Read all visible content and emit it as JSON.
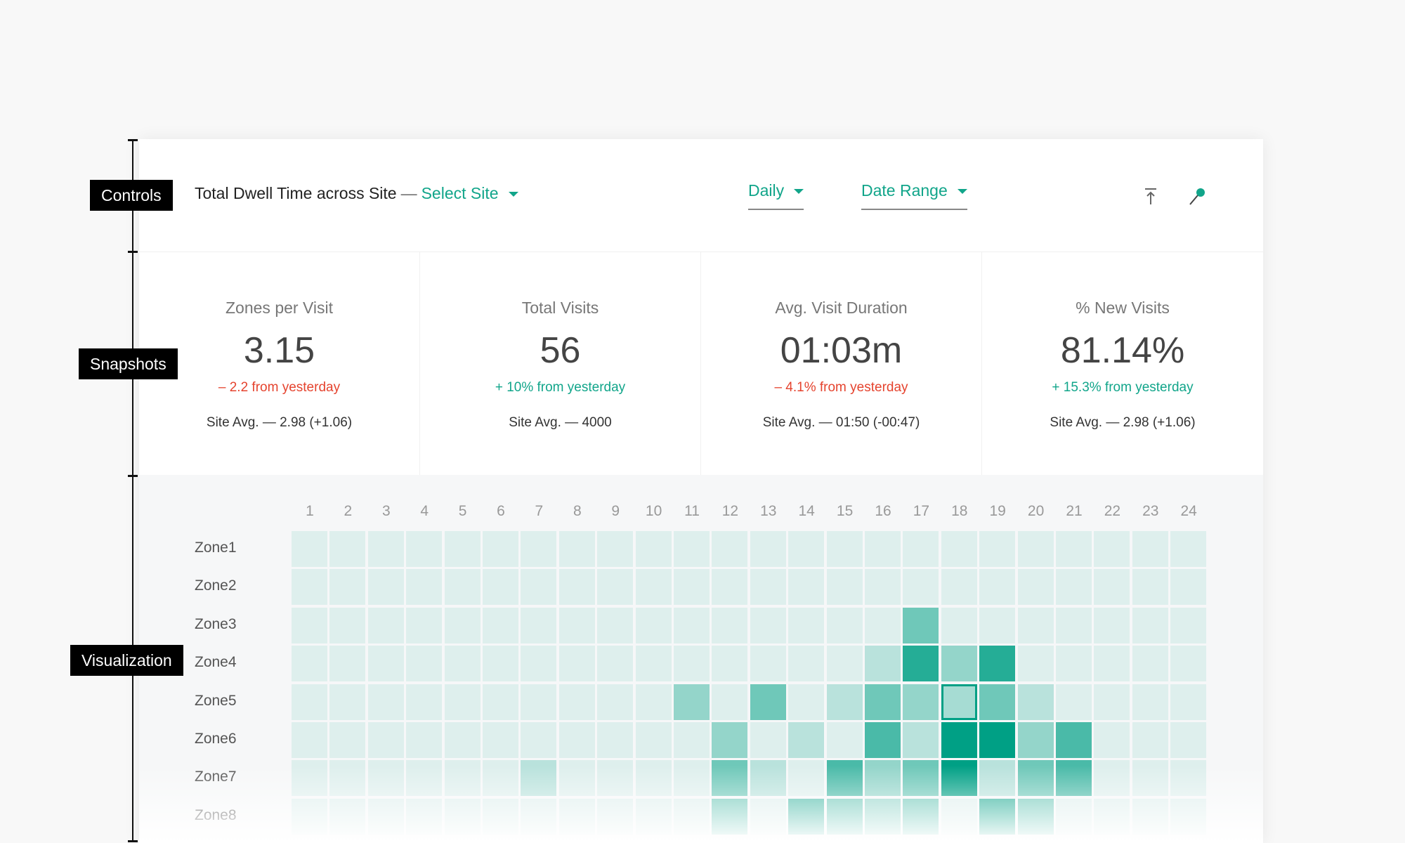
{
  "annotations": [
    "Controls",
    "Snapshots",
    "Visualization"
  ],
  "controls": {
    "title": "Total Dwell Time across Site",
    "separator": "—",
    "site_select": "Select Site",
    "interval": "Daily",
    "date_range": "Date Range"
  },
  "snapshots": [
    {
      "label": "Zones per Visit",
      "value": "3.15",
      "change": "– 2.2 from yesterday",
      "trend": "negative",
      "site_avg": "Site Avg. — 2.98 (+1.06)"
    },
    {
      "label": "Total Visits",
      "value": "56",
      "change": "+ 10% from yesterday",
      "trend": "positive",
      "site_avg": "Site Avg. — 4000"
    },
    {
      "label": "Avg. Visit Duration",
      "value": "01:03m",
      "change": "– 4.1% from yesterday",
      "trend": "negative",
      "site_avg": "Site Avg. — 01:50 (-00:47)"
    },
    {
      "label": "% New Visits",
      "value": "81.14%",
      "change": "+ 15.3% from yesterday",
      "trend": "positive",
      "site_avg": "Site Avg. — 2.98 (+1.06)"
    }
  ],
  "colors": {
    "accent": "#11a58a",
    "negative": "#e5432e",
    "cell_low": "#deefed",
    "cell_high": "#00a085"
  },
  "chart_data": {
    "type": "heatmap",
    "x": [
      "1",
      "2",
      "3",
      "4",
      "5",
      "6",
      "7",
      "8",
      "9",
      "10",
      "11",
      "12",
      "13",
      "14",
      "15",
      "16",
      "17",
      "18",
      "19",
      "20",
      "21",
      "22",
      "23",
      "24"
    ],
    "y": [
      "Zone1",
      "Zone2",
      "Zone3",
      "Zone4",
      "Zone5",
      "Zone6",
      "Zone7",
      "Zone8"
    ],
    "values": [
      [
        0,
        0,
        0,
        0,
        0,
        0,
        0,
        0,
        0,
        0,
        0,
        0,
        0,
        0,
        0,
        0,
        0,
        0,
        0,
        0,
        0,
        0,
        0,
        0
      ],
      [
        0,
        0,
        0,
        0,
        0,
        0,
        0,
        0,
        0,
        0,
        0,
        0,
        0,
        0,
        0,
        0,
        0,
        0,
        0,
        0,
        0,
        0,
        0,
        0
      ],
      [
        0,
        0,
        0,
        0,
        0,
        0,
        0,
        0,
        0,
        0,
        0,
        0,
        0,
        0,
        0,
        0,
        3,
        0,
        0,
        0,
        0,
        0,
        0,
        0
      ],
      [
        0,
        0,
        0,
        0,
        0,
        0,
        0,
        0,
        0,
        0,
        0,
        0,
        0,
        0,
        0,
        1,
        5,
        2,
        5,
        0,
        0,
        0,
        0,
        0
      ],
      [
        0,
        0,
        0,
        0,
        0,
        0,
        0,
        0,
        0,
        0,
        2,
        0,
        3,
        0,
        1,
        3,
        2,
        1,
        3,
        1,
        0,
        0,
        0,
        0
      ],
      [
        0,
        0,
        0,
        0,
        0,
        0,
        0,
        0,
        0,
        0,
        0,
        2,
        0,
        1,
        0,
        4,
        1,
        6,
        6,
        2,
        4,
        0,
        0,
        0
      ],
      [
        0,
        0,
        0,
        0,
        0,
        0,
        1,
        0,
        0,
        0,
        0,
        3,
        1,
        0,
        4,
        2,
        3,
        6,
        1,
        3,
        4,
        0,
        0,
        0
      ],
      [
        0,
        0,
        0,
        0,
        0,
        0,
        0,
        0,
        0,
        0,
        0,
        3,
        0,
        4,
        3,
        2,
        3,
        0,
        5,
        3,
        0,
        0,
        0,
        0
      ]
    ],
    "scale_max": 6,
    "selected_cell": {
      "zone": "Zone5",
      "hour": "18"
    }
  }
}
